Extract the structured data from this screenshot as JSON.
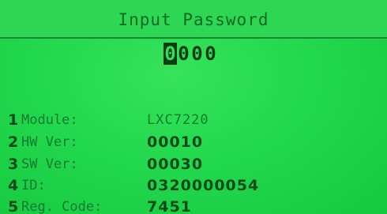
{
  "header": {
    "title": "Input Password"
  },
  "password": {
    "digits": [
      "0",
      "0",
      "0",
      "0"
    ]
  },
  "info_rows": [
    {
      "number": "1",
      "label": "Module:",
      "value": "LXC7220"
    },
    {
      "number": "2",
      "label": "HW Ver:",
      "value": "00010"
    },
    {
      "number": "3",
      "label": "SW Ver:",
      "value": "00030"
    },
    {
      "number": "4",
      "label": "ID:",
      "value": "0320000054"
    },
    {
      "number": "5",
      "label": "Reg. Code:",
      "value": "7451"
    }
  ],
  "colors": {
    "background": "#22d84d",
    "text_dark": "#0b4a1a",
    "text_light": "#137a32"
  }
}
